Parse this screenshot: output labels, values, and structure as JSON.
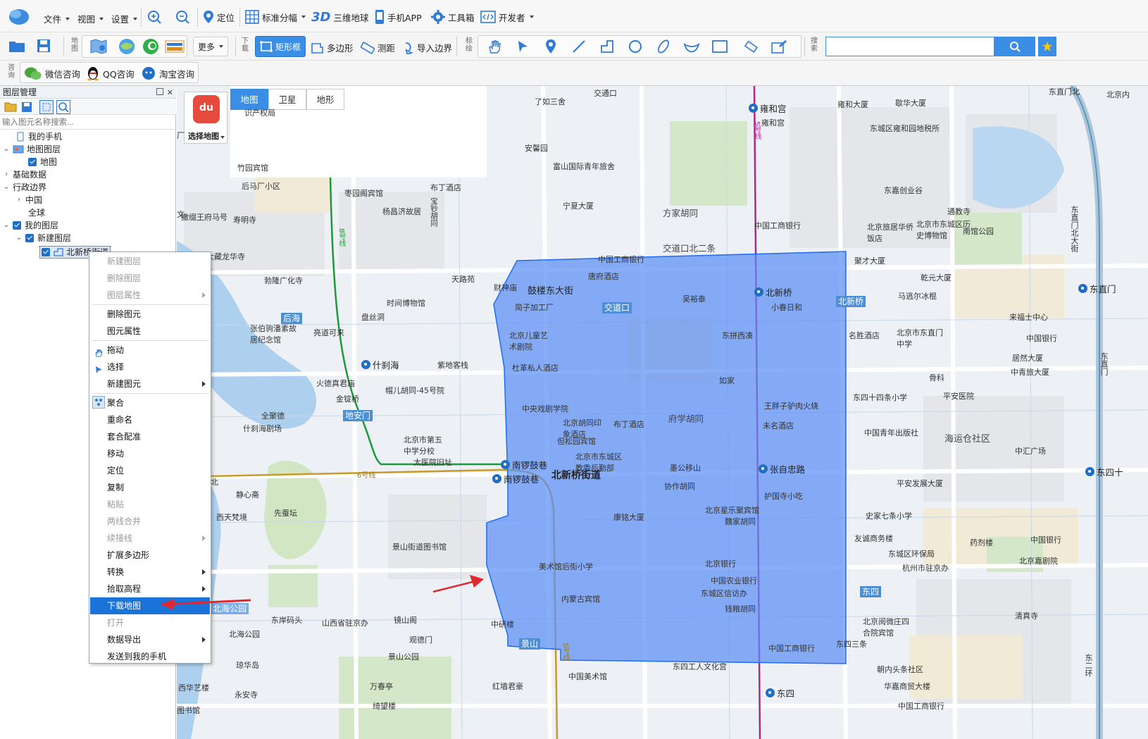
{
  "toolbar": {
    "menus": [
      "文件",
      "视图",
      "设置"
    ],
    "locate": "定位",
    "tile": "标准分幅",
    "earth3d_badge": "3D",
    "earth3d": "三维地球",
    "mobile": "手机APP",
    "toolbox": "工具箱",
    "developer": "开发者"
  },
  "toolbar2": {
    "map_group_label": "地图",
    "more": "更多",
    "download_group_label": "下载",
    "rect": "矩形框",
    "polygon": "多边形",
    "measure": "测距",
    "import_boundary": "导入边界",
    "draw_group_label": "标绘",
    "search_group_label": "搜索",
    "search_value": ""
  },
  "toolbar3": {
    "consult_label": "咨询",
    "wechat": "微信咨询",
    "qq": "QQ咨询",
    "taobao": "淘宝咨询"
  },
  "layer_panel": {
    "title": "图层管理",
    "search_placeholder": "输入图元名称搜索...",
    "tree": {
      "my_phone": "我的手机",
      "map_layers": "地图图层",
      "map": "地图",
      "base_data": "基础数据",
      "admin_boundary": "行政边界",
      "china": "中国",
      "global": "全球",
      "my_layers": "我的图层",
      "new_layer": "新建图层",
      "element": "北新桥街道"
    }
  },
  "context_menu": [
    {
      "label": "新建图层",
      "disabled": true
    },
    {
      "label": "删除图层",
      "disabled": true
    },
    {
      "label": "图层属性",
      "disabled": true,
      "submenu": true
    },
    {
      "label": "删除图元"
    },
    {
      "label": "图元属性"
    },
    {
      "label": "拖动",
      "icon": "hand"
    },
    {
      "label": "选择",
      "icon": "pointer"
    },
    {
      "label": "新建图元",
      "submenu": true
    },
    {
      "label": "聚合",
      "icon": "cluster"
    },
    {
      "label": "重命名"
    },
    {
      "label": "套合配准"
    },
    {
      "label": "移动"
    },
    {
      "label": "定位"
    },
    {
      "label": "复制"
    },
    {
      "label": "粘贴",
      "disabled": true
    },
    {
      "label": "两线合并",
      "disabled": true
    },
    {
      "label": "续接线",
      "disabled": true,
      "submenu": true
    },
    {
      "label": "扩展多边形"
    },
    {
      "label": "转换",
      "submenu": true
    },
    {
      "label": "拾取高程",
      "submenu": true
    },
    {
      "label": "下载地图",
      "highlighted": true
    },
    {
      "label": "打开",
      "disabled": true
    },
    {
      "label": "数据导出",
      "submenu": true
    },
    {
      "label": "发送到我的手机"
    }
  ],
  "map": {
    "selector_label": "选择地图",
    "selector_logo": "du",
    "types": [
      "地图",
      "卫星",
      "地形"
    ],
    "active_type": "地图",
    "colors": {
      "polygon": "#5b8ff5",
      "accent": "#1a73d9",
      "metro_line5": "#b0268f",
      "metro_line8": "#1c9a3b",
      "metro_line6": "#c79a2a",
      "arrow": "#e0282e"
    },
    "poi": [
      "交通口",
      "了如三舍",
      "雍和宫",
      "雍和大厦",
      "歇华大厦",
      "雍和宫",
      "东城区雍和园地税所",
      "识产权局",
      "安馨园",
      "富山国际青年旅舍",
      "竹园宾馆",
      "后马厂小区",
      "枣园阁宾馆",
      "布丁酒店",
      "宝钞胡同",
      "东嘉创业谷",
      "通教寺",
      "寿明寺",
      "杨昌济故居",
      "宁夏大厦",
      "方家胡同",
      "中国工商银行",
      "北京旅居华侨饭店",
      "北京市东城区历史博物馆",
      "南馆公园",
      "撒缀王府马号",
      "交道口北二条",
      "大藏龙华寺",
      "中国工商银行",
      "聚才大厦",
      "勃隆广化寺",
      "天路苑",
      "唐府酒店",
      "财神庙",
      "鼓楼东大街",
      "北新桥",
      "乾元大厦",
      "马逃尔冰棍",
      "时间博物馆",
      "吴裕泰",
      "北新桥",
      "后海",
      "盘丝洞",
      "简子加工厂",
      "交道口",
      "小春日和",
      "来福士中心",
      "张伯驹潘素故居纪念馆",
      "亮道可来",
      "北京儿童艺术剧院",
      "东拼西凑",
      "名胜酒店",
      "北京市东直门中学",
      "中国银行",
      "什刹海",
      "紫地客栈",
      "杜革私人酒店",
      "居然大厦",
      "中青旅大厦",
      "火德真君庙",
      "帽儿胡同-45号院",
      "如家",
      "骨科",
      "东四十四条小学",
      "平安医院",
      "金锭桥",
      "中央戏剧学院",
      "王胖子驴肉火烧",
      "全聚德",
      "地安门",
      "北京胡同印象酒店",
      "布丁酒店",
      "府学胡同",
      "未名酒店",
      "中国青年出版社",
      "海运仓社区",
      "什刹海剧场",
      "北京市第五中学分校",
      "但松园宾馆",
      "中汇广场",
      "太医院旧址",
      "北京市东城区教委后勤部",
      "南锣鼓巷",
      "北新桥街道",
      "墨公移山",
      "张自忠路",
      "南锣鼓巷",
      "6号线",
      "协作胡同",
      "平安发展大厦",
      "静心斋",
      "护国寺小吃",
      "西天梵境",
      "先蚕坛",
      "康铭大厦",
      "北京星乐聚宾馆",
      "魏家胡同",
      "史家七条小学",
      "友诚商务楼",
      "药剂楼",
      "中国银行",
      "景山街道图书馆",
      "东城区环保局",
      "美术馆后街小学",
      "北京银行",
      "北京嘉剧院",
      "杭州市驻京办",
      "中国农业银行",
      "东城区信访办",
      "东四",
      "内蒙古宾馆",
      "北海公园",
      "钱粮胡同",
      "东岸码头",
      "山西省驻京办",
      "镜山阁",
      "中研楼",
      "清真寺",
      "北京阅微庄四合院宾馆",
      "北海公园",
      "观德门",
      "景山",
      "中国工商银行",
      "东四三条",
      "琼华岛",
      "景山公园",
      "东四工人文化宫",
      "朝内头条社区",
      "西华艺楼",
      "万春亭",
      "中国美术馆",
      "红墙君豪",
      "华嘉商贸大楼",
      "永安寺",
      "东四",
      "绮望楼",
      "中国工商银行",
      "东直门北",
      "东直门北大街",
      "东直门",
      "东二环",
      "东四十",
      "东直门",
      "北京内",
      "图书馆",
      "5号线",
      "8号线",
      "5号线",
      "北",
      "厂",
      "玉山",
      "遇南",
      "文"
    ]
  }
}
